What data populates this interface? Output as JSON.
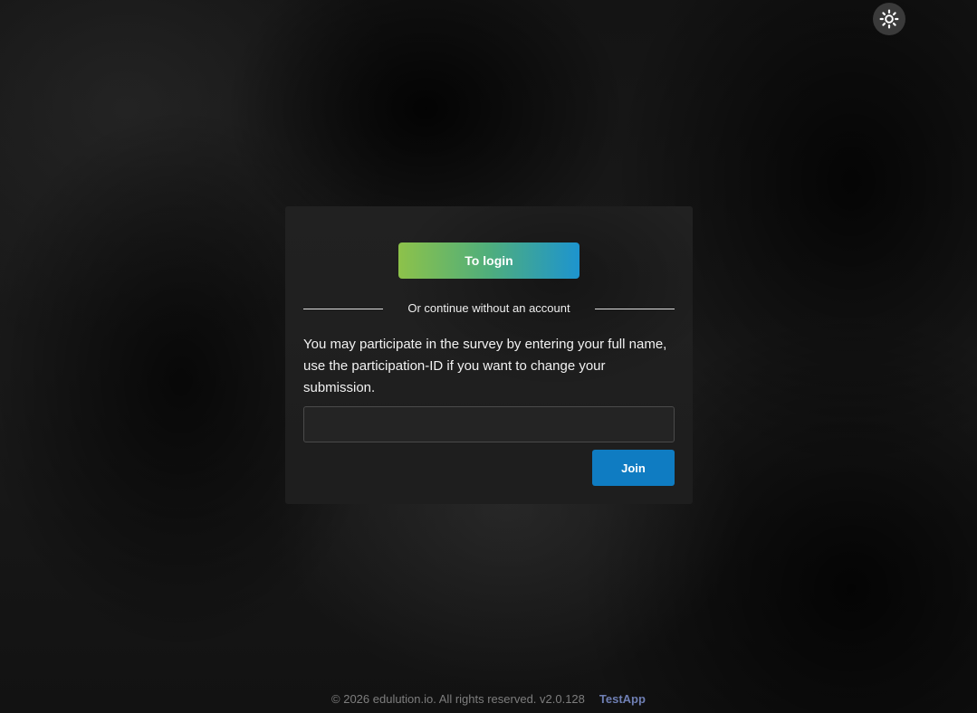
{
  "header": {
    "theme_toggle_icon": "sun-icon"
  },
  "card": {
    "login_button_label": "To login",
    "divider_text": "Or continue without an account",
    "description": "You may participate in the survey by entering your full name, use the participation-ID if you want to change your submission.",
    "name_input": {
      "value": "",
      "placeholder": ""
    },
    "join_button_label": "Join"
  },
  "footer": {
    "copyright": "© 2026 edulution.io. All rights reserved. v2.0.128",
    "app_link": "TestApp"
  },
  "colors": {
    "join_button": "#0f7cc2",
    "login_gradient_start": "#8dc24a",
    "login_gradient_end": "#1d94cf",
    "app_link": "#6f7fb4"
  }
}
